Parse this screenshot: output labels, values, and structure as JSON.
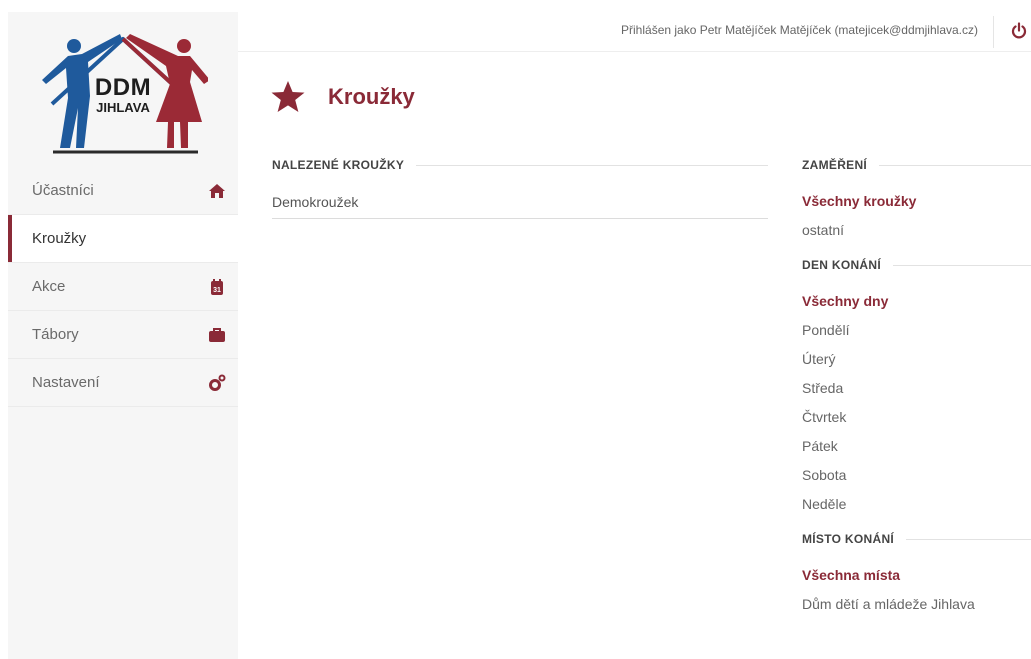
{
  "logo": {
    "line1": "DDM",
    "line2": "JIHLAVA"
  },
  "sidebar": {
    "items": [
      {
        "label": "Účastníci",
        "icon": "home-icon",
        "active": false
      },
      {
        "label": "Kroužky",
        "icon": "",
        "active": true
      },
      {
        "label": "Akce",
        "icon": "calendar-icon",
        "active": false
      },
      {
        "label": "Tábory",
        "icon": "briefcase-icon",
        "active": false
      },
      {
        "label": "Nastavení",
        "icon": "cogs-icon",
        "active": false
      }
    ],
    "calendar_day": "31"
  },
  "header": {
    "user_info": "Přihlášen jako Petr Matějíček Matějíček (matejicek@ddmjihlava.cz)"
  },
  "page": {
    "title": "Kroužky",
    "title_icon": "star-icon"
  },
  "results": {
    "heading": "NALEZENÉ KROUŽKY",
    "items": [
      "Demokroužek"
    ]
  },
  "filters": {
    "focus": {
      "heading": "ZAMĚŘENÍ",
      "options": [
        "Všechny kroužky",
        "ostatní"
      ],
      "selected": "Všechny kroužky"
    },
    "day": {
      "heading": "DEN KONÁNÍ",
      "options": [
        "Všechny dny",
        "Pondělí",
        "Úterý",
        "Středa",
        "Čtvrtek",
        "Pátek",
        "Sobota",
        "Neděle"
      ],
      "selected": "Všechny dny"
    },
    "place": {
      "heading": "MÍSTO KONÁNÍ",
      "options": [
        "Všechna místa",
        "Dům dětí a mládeže Jihlava"
      ],
      "selected": "Všechna místa"
    }
  },
  "colors": {
    "accent": "#8a2a37",
    "logo_blue": "#1f5a9c",
    "logo_red": "#9b2a36",
    "sidebar_bg": "#f6f6f6"
  }
}
